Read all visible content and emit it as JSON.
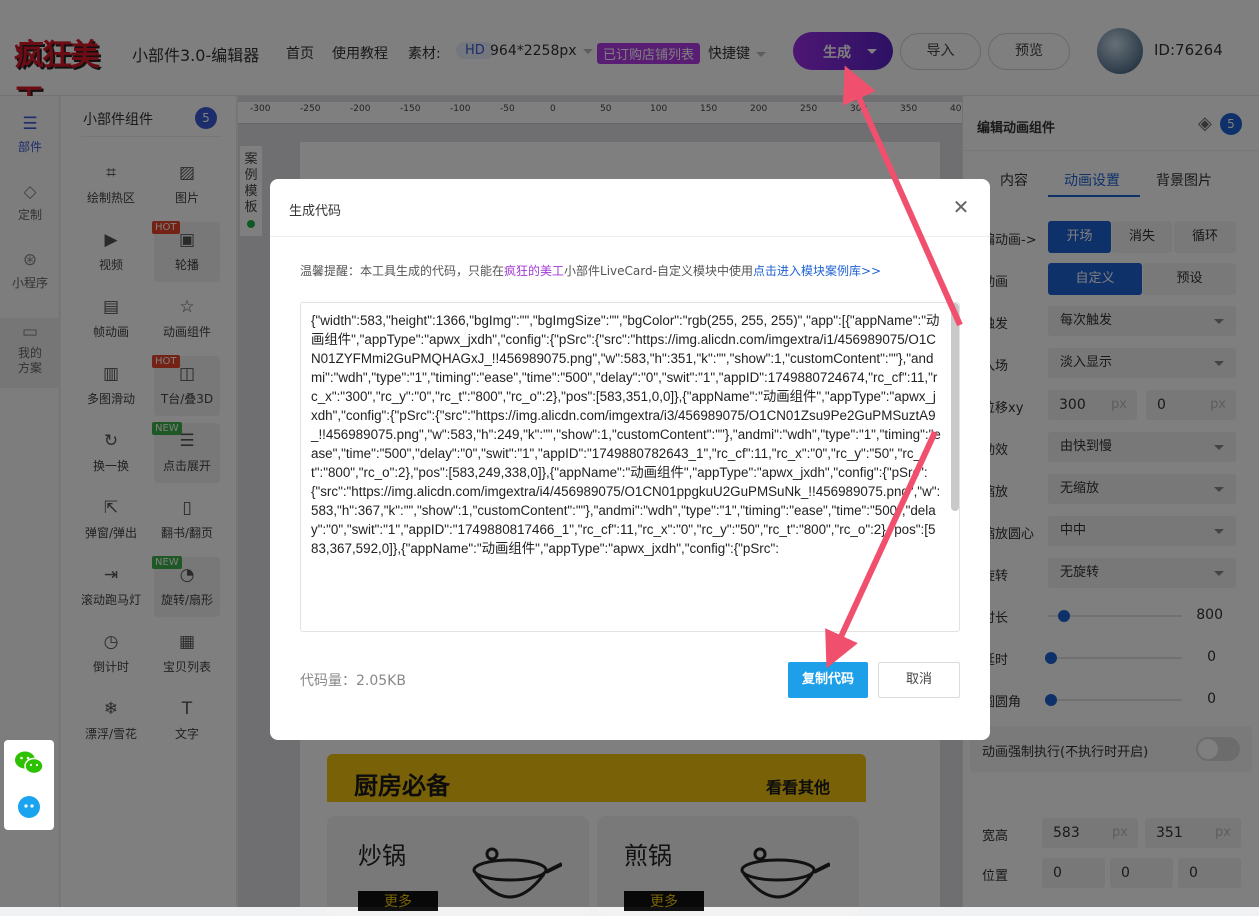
{
  "header": {
    "logo_text": "疯狂美工",
    "app_title": "小部件3.0-编辑器",
    "nav": [
      "首页",
      "使用教程"
    ],
    "material_label": "素材:",
    "hd_badge": "HD",
    "material_size": "964*2258px",
    "shop_badge": "已订购店铺列表",
    "shortcut_label": "快捷键",
    "generate_label": "生成",
    "import_label": "导入",
    "preview_label": "预览",
    "user_id": "ID:76264"
  },
  "left_nav": [
    {
      "label": "部件",
      "icon": "list-icon",
      "active": true
    },
    {
      "label": "定制",
      "icon": "diamond-icon",
      "active": false
    },
    {
      "label": "小程序",
      "icon": "miniprogram-icon",
      "active": false
    },
    {
      "label": "我的方案",
      "icon": "folder-icon",
      "active": false
    }
  ],
  "components": {
    "title": "小部件组件",
    "count": "5",
    "items": [
      {
        "label": "绘制热区",
        "icon": "hotzone-icon",
        "tag": ""
      },
      {
        "label": "图片",
        "icon": "image-icon",
        "tag": ""
      },
      {
        "label": "视频",
        "icon": "video-icon",
        "tag": ""
      },
      {
        "label": "轮播",
        "icon": "carousel-icon",
        "tag": "HOT"
      },
      {
        "label": "帧动画",
        "icon": "frame-animation-icon",
        "tag": ""
      },
      {
        "label": "动画组件",
        "icon": "star-icon",
        "tag": ""
      },
      {
        "label": "多图滑动",
        "icon": "multi-slide-icon",
        "tag": ""
      },
      {
        "label": "T台/叠3D",
        "icon": "stage-3d-icon",
        "tag": "HOT"
      },
      {
        "label": "换一换",
        "icon": "refresh-icon",
        "tag": ""
      },
      {
        "label": "点击展开",
        "icon": "expand-icon",
        "tag": "NEW"
      },
      {
        "label": "弹窗/弹出",
        "icon": "popup-icon",
        "tag": ""
      },
      {
        "label": "翻书/翻页",
        "icon": "book-icon",
        "tag": ""
      },
      {
        "label": "滚动跑马灯",
        "icon": "marquee-icon",
        "tag": ""
      },
      {
        "label": "旋转/扇形",
        "icon": "rotate-icon",
        "tag": "NEW"
      },
      {
        "label": "倒计时",
        "icon": "clock-icon",
        "tag": ""
      },
      {
        "label": "宝贝列表",
        "icon": "grid-icon",
        "tag": ""
      },
      {
        "label": "漂浮/雪花",
        "icon": "snowflake-icon",
        "tag": ""
      },
      {
        "label": "文字",
        "icon": "text-icon",
        "tag": ""
      }
    ]
  },
  "ruler": {
    "ticks": [
      "-300",
      "-250",
      "-200",
      "-150",
      "-100",
      "-50",
      "0",
      "50",
      "100",
      "150",
      "200",
      "250",
      "300",
      "350",
      "400"
    ]
  },
  "canvas": {
    "side_tab": "案例模板",
    "banner_left": "厨房必备",
    "banner_right": "看看其他",
    "card1_title": "炒锅",
    "card2_title": "煎锅",
    "more_label": "更多"
  },
  "right_panel": {
    "title": "编辑动画组件",
    "layer_count": "5",
    "tabs": [
      "内容",
      "动画设置",
      "背景图片"
    ],
    "active_tab": "动画设置",
    "rows": {
      "anim_label": "编动画->",
      "anim_opts": [
        "开场",
        "消失",
        "循环"
      ],
      "mode_label": "动画",
      "mode_opts": [
        "自定义",
        "预设"
      ],
      "trigger_label": "触发",
      "trigger_value": "每次触发",
      "enter_label": "入场",
      "enter_value": "淡入显示",
      "offset_label": "位移xy",
      "offset_x": "300",
      "offset_y": "0",
      "unit": "px",
      "easing_label": "动效",
      "easing_value": "由快到慢",
      "scale_label": "缩放",
      "scale_value": "无缩放",
      "origin_label": "缩放圆心",
      "origin_value": "中中",
      "rotate_label": "旋转",
      "rotate_value": "无旋转",
      "duration_label": "时长",
      "duration_value": "800",
      "delay_label": "延时",
      "delay_value": "0",
      "radius_label": "圆圆角",
      "radius_value": "0",
      "force_label": "动画强制执行(不执行时开启)",
      "size_label": "宽高",
      "width": "583",
      "height": "351",
      "pos_label": "位置",
      "pos_x": "0",
      "pos_y": "0",
      "pos_z": "0"
    },
    "slider_levels": {
      "duration": 0.1,
      "delay": 0,
      "radius": 0
    }
  },
  "modal": {
    "title": "生成代码",
    "notice_prefix": "温馨提醒：本工具生成的代码，只能在",
    "notice_brand": "疯狂的美工",
    "notice_mid": "小部件LiveCard-自定义模块中使用",
    "notice_link": "点击进入模块案例库>>",
    "code": "{\"width\":583,\"height\":1366,\"bgImg\":\"\",\"bgImgSize\":\"\",\"bgColor\":\"rgb(255, 255, 255)\",\"app\":[{\"appName\":\"动画组件\",\"appType\":\"apwx_jxdh\",\"config\":{\"pSrc\":{\"src\":\"https://img.alicdn.com/imgextra/i1/456989075/O1CN01ZYFMmi2GuPMQHAGxJ_!!456989075.png\",\"w\":583,\"h\":351,\"k\":\"\",\"show\":1,\"customContent\":\"\"},\"andmi\":\"wdh\",\"type\":\"1\",\"timing\":\"ease\",\"time\":\"500\",\"delay\":\"0\",\"swit\":\"1\",\"appID\":1749880724674,\"rc_cf\":11,\"rc_x\":\"300\",\"rc_y\":\"0\",\"rc_t\":\"800\",\"rc_o\":2},\"pos\":[583,351,0,0]},{\"appName\":\"动画组件\",\"appType\":\"apwx_jxdh\",\"config\":{\"pSrc\":{\"src\":\"https://img.alicdn.com/imgextra/i3/456989075/O1CN01Zsu9Pe2GuPMSuztA9_!!456989075.png\",\"w\":583,\"h\":249,\"k\":\"\",\"show\":1,\"customContent\":\"\"},\"andmi\":\"wdh\",\"type\":\"1\",\"timing\":\"ease\",\"time\":\"500\",\"delay\":\"0\",\"swit\":\"1\",\"appID\":\"1749880782643_1\",\"rc_cf\":11,\"rc_x\":\"0\",\"rc_y\":\"50\",\"rc_t\":\"800\",\"rc_o\":2},\"pos\":[583,249,338,0]},{\"appName\":\"动画组件\",\"appType\":\"apwx_jxdh\",\"config\":{\"pSrc\":{\"src\":\"https://img.alicdn.com/imgextra/i4/456989075/O1CN01ppgkuU2GuPMSuNk_!!456989075.png\",\"w\":583,\"h\":367,\"k\":\"\",\"show\":1,\"customContent\":\"\"},\"andmi\":\"wdh\",\"type\":\"1\",\"timing\":\"ease\",\"time\":\"500\",\"delay\":\"0\",\"swit\":\"1\",\"appID\":\"1749880817466_1\",\"rc_cf\":11,\"rc_x\":\"0\",\"rc_y\":\"50\",\"rc_t\":\"800\",\"rc_o\":2},\"pos\":[583,367,592,0]},{\"appName\":\"动画组件\",\"appType\":\"apwx_jxdh\",\"config\":{\"pSrc\":",
    "code_size": "代码量：2.05KB",
    "copy_label": "复制代码",
    "cancel_label": "取消"
  },
  "colors": {
    "accent": "#1f63d4",
    "generate": "#7b27d8",
    "arrow": "#f0506e",
    "banner": "#f1c30e",
    "copy": "#1ea0e8"
  }
}
